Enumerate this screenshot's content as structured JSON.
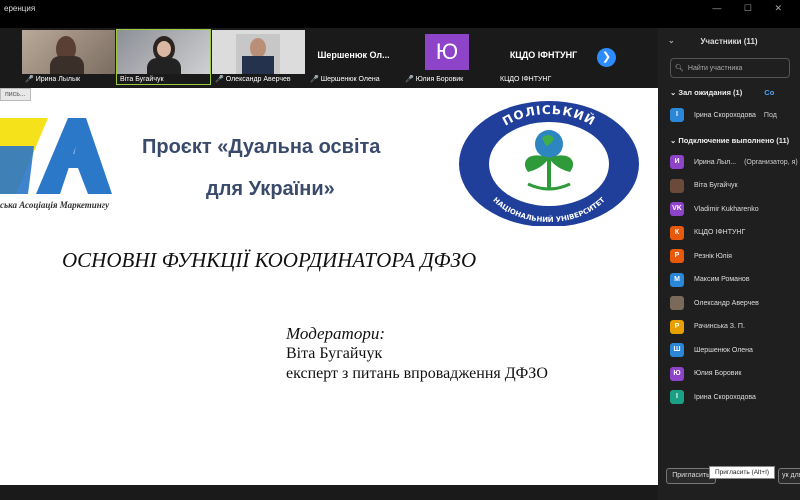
{
  "titlebar": {
    "title": "еренция",
    "controls": "— ☐ ✕"
  },
  "tiles": [
    {
      "name": "Ирина Лылык",
      "muted": true
    },
    {
      "name": "Віта Бугайчук",
      "muted": false
    },
    {
      "name": "Олександр Аверчев",
      "muted": true
    },
    {
      "name": "Шершенюк Олена",
      "muted": true,
      "bigname": "Шершенюк Ол..."
    },
    {
      "name": "Юлия Боровик",
      "muted": true,
      "avatar_letter": "Ю"
    },
    {
      "name": "КЦДО ІФНТУНГ",
      "muted": false,
      "bigname": "КЦДО ІФНТУНГ"
    }
  ],
  "next_icon": "chevron-right-icon",
  "slide": {
    "rec_label": "пись...",
    "project_line1": "Проєкт «Дуальна освіта",
    "project_line2": "для України»",
    "assoc_text": "ська Асоціація Маркетингу",
    "logo_top_text": "ПОЛІСЬКИЙ",
    "logo_bottom_text": "НАЦІОНАЛЬНИЙ УНІВЕРСИТЕТ",
    "heading": "ОСНОВНІ ФУНКЦІЇ КООРДИНАТОРА ДФЗО",
    "moderators_label": "Модератори:",
    "moderator_name": "Віта Бугайчук",
    "moderator_role": "експерт з питань впровадження ДФЗО"
  },
  "panel": {
    "title": "Участники (11)",
    "search_placeholder": "Найти участника",
    "waiting_label": "Зал ожидания (1)",
    "waiting_action": "Со",
    "waiting": [
      {
        "name": "Ірина Скороходова",
        "letter": "І",
        "color": "#2b88d8",
        "extra": "Под"
      }
    ],
    "connected_label": "Подключение выполнено (11)",
    "participants": [
      {
        "name": "Ирина Лыл...",
        "letter": "И",
        "color": "#8e44c9",
        "extra": "(Организатор, я)"
      },
      {
        "name": "Віта Бугайчук",
        "letter": "",
        "color": "#6b4a3a",
        "extra": ""
      },
      {
        "name": "Vladimir Kukharenko",
        "letter": "VK",
        "color": "#8e44c9",
        "extra": ""
      },
      {
        "name": "КЦДО ІФНТУНГ",
        "letter": "К",
        "color": "#e8590c",
        "extra": ""
      },
      {
        "name": "Резнік Юлія",
        "letter": "Р",
        "color": "#e8590c",
        "extra": ""
      },
      {
        "name": "Максим Романов",
        "letter": "М",
        "color": "#2b88d8",
        "extra": ""
      },
      {
        "name": "Олександр Аверчев",
        "letter": "",
        "color": "#7a6a5a",
        "extra": ""
      },
      {
        "name": "Рачинська З. П.",
        "letter": "Р",
        "color": "#e6a100",
        "extra": ""
      },
      {
        "name": "Шершенюк Олена",
        "letter": "Ш",
        "color": "#2b88d8",
        "extra": ""
      },
      {
        "name": "Юлия Боровик",
        "letter": "Ю",
        "color": "#8e44c9",
        "extra": ""
      },
      {
        "name": "Ірина Скороходова",
        "letter": "І",
        "color": "#1aa085",
        "extra": ""
      }
    ],
    "invite_label": "Пригласить",
    "invite_tooltip": "Пригласить (Alt+I)",
    "mute_all_label": "ук для в"
  }
}
